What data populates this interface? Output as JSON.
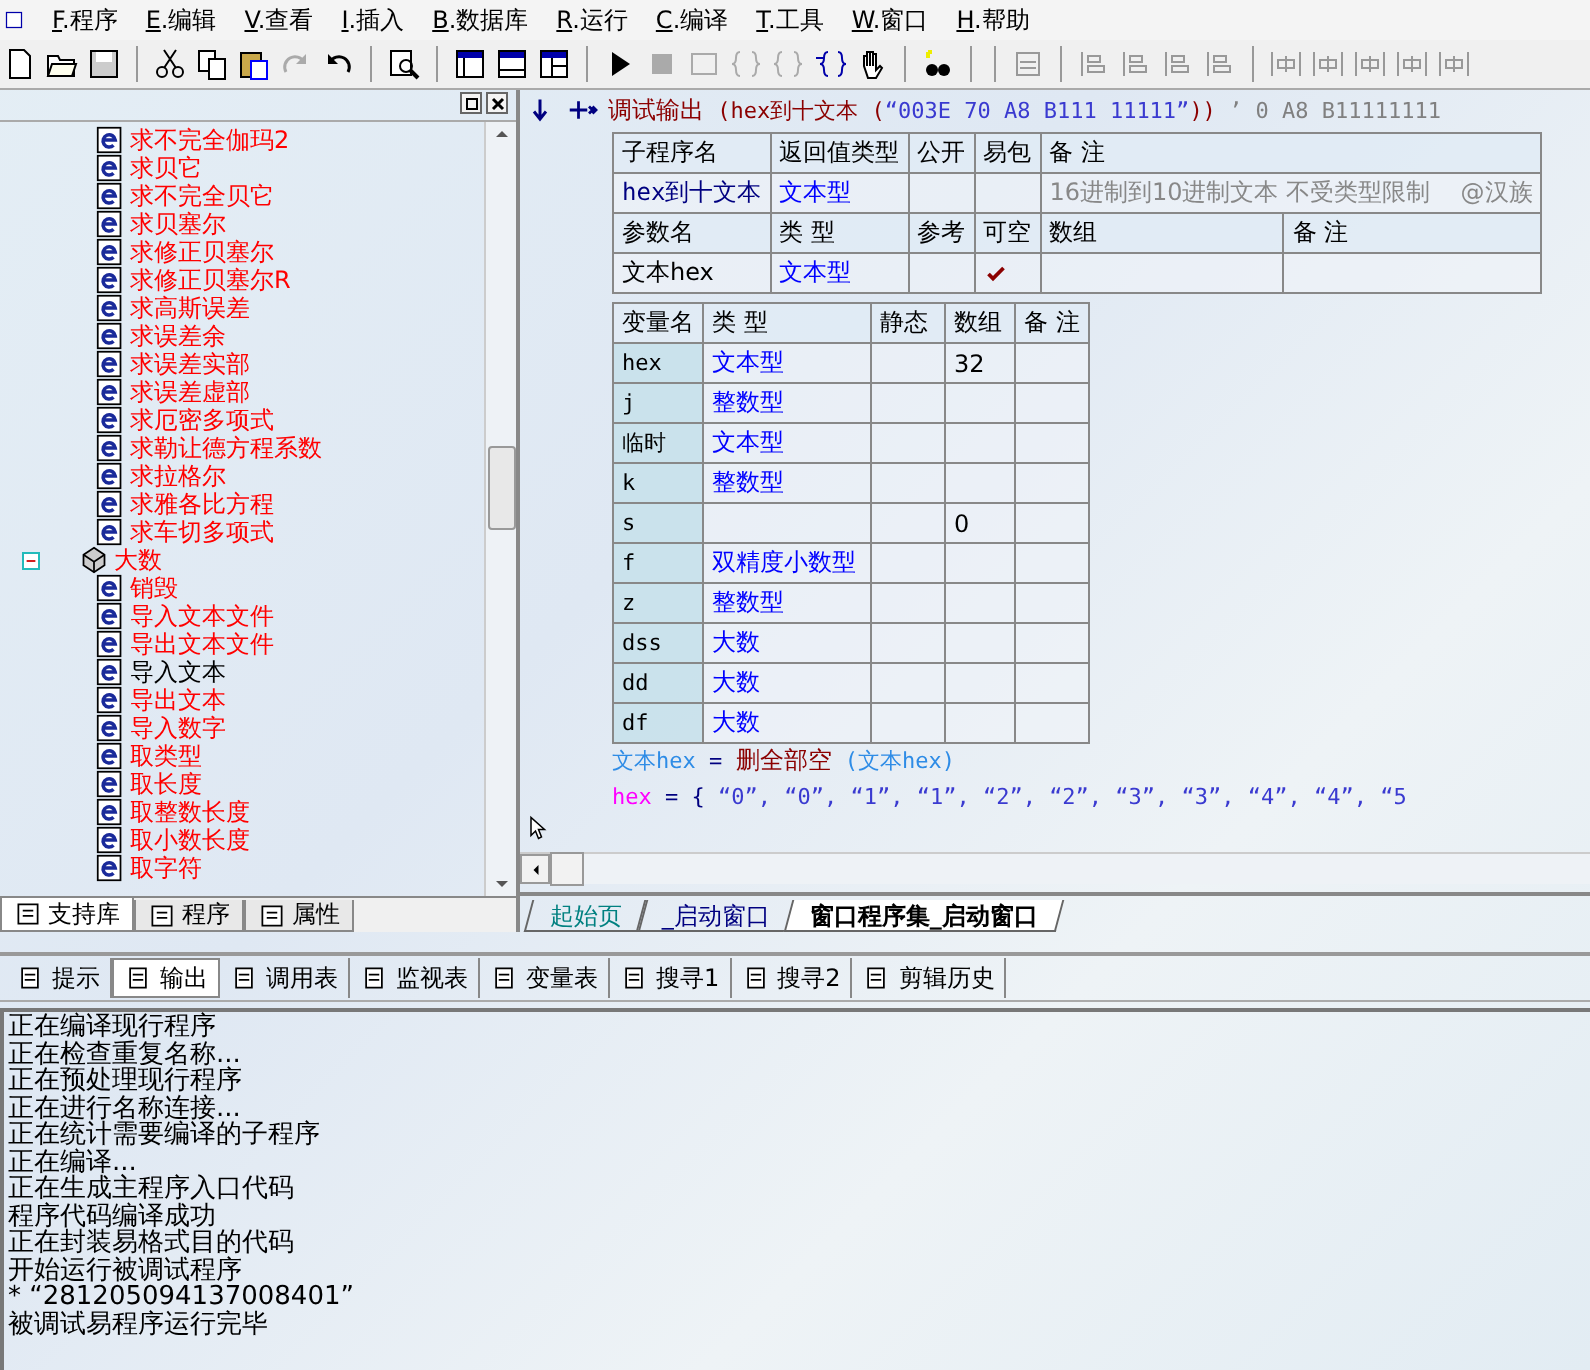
{
  "menu": [
    "F.程序",
    "E.编辑",
    "V.查看",
    "I.插入",
    "B.数据库",
    "R.运行",
    "C.编译",
    "T.工具",
    "W.窗口",
    "H.帮助"
  ],
  "library_tree": {
    "scrolled_group": [
      {
        "label": "求不完全伽玛2",
        "color": "#ff0000"
      },
      {
        "label": "求贝它",
        "color": "#ff0000"
      },
      {
        "label": "求不完全贝它",
        "color": "#ff0000"
      },
      {
        "label": "求贝塞尔",
        "color": "#ff0000"
      },
      {
        "label": "求修正贝塞尔",
        "color": "#ff0000"
      },
      {
        "label": "求修正贝塞尔R",
        "color": "#ff0000"
      },
      {
        "label": "求高斯误差",
        "color": "#ff0000"
      },
      {
        "label": "求误差余",
        "color": "#ff0000"
      },
      {
        "label": "求误差实部",
        "color": "#ff0000"
      },
      {
        "label": "求误差虚部",
        "color": "#ff0000"
      },
      {
        "label": "求厄密多项式",
        "color": "#ff0000"
      },
      {
        "label": "求勒让德方程系数",
        "color": "#ff0000"
      },
      {
        "label": "求拉格尔",
        "color": "#ff0000"
      },
      {
        "label": "求雅各比方程",
        "color": "#ff0000"
      },
      {
        "label": "求车切多项式",
        "color": "#ff0000"
      }
    ],
    "nodes": [
      {
        "label": "大数",
        "color": "#ff0000",
        "expanded": true,
        "children": [
          {
            "label": "销毁",
            "color": "#ff0000"
          },
          {
            "label": "导入文本文件",
            "color": "#ff0000"
          },
          {
            "label": "导出文本文件",
            "color": "#ff0000"
          },
          {
            "label": "导入文本",
            "color": "#000000"
          },
          {
            "label": "导出文本",
            "color": "#ff0000"
          },
          {
            "label": "导入数字",
            "color": "#ff0000"
          },
          {
            "label": "取类型",
            "color": "#ff0000"
          },
          {
            "label": "取长度",
            "color": "#ff0000"
          },
          {
            "label": "取整数长度",
            "color": "#ff0000"
          },
          {
            "label": "取小数长度",
            "color": "#ff0000"
          },
          {
            "label": "取字符",
            "color": "#ff0000"
          }
        ]
      }
    ]
  },
  "left_tabs": [
    {
      "label": "支持库",
      "selected": true
    },
    {
      "label": "程序",
      "selected": false
    },
    {
      "label": "属性",
      "selected": false
    }
  ],
  "editor": {
    "first_line": [
      {
        "text": "调试输出",
        "kind": "command"
      },
      {
        "text": " (hex到十文本 (",
        "kind": "call"
      },
      {
        "text": "“003E 70 A8 B111 11111”",
        "kind": "string"
      },
      {
        "text": "))",
        "kind": "call"
      },
      {
        "text": " ’ 0 A8 B11111111",
        "kind": "comment"
      }
    ],
    "sub_table": {
      "header": [
        "子程序名",
        "返回值类型",
        "公开",
        "易包",
        "备 注"
      ],
      "name": "hex到十文本",
      "return_type": "文本型",
      "public": false,
      "easy_pack": false,
      "note": "16进制到10进制文本 不受类型限制    @汉族",
      "param_header": [
        "参数名",
        "类 型",
        "参考",
        "可空",
        "数组",
        "备 注"
      ],
      "params": [
        {
          "name": "文本hex",
          "type": "文本型",
          "reference": false,
          "nullable": true,
          "array": false
        }
      ]
    },
    "var_table": {
      "header": [
        "变量名",
        "类 型",
        "静态",
        "数组",
        "备 注"
      ],
      "rows": [
        {
          "name": "hex",
          "type": "文本型",
          "static": false,
          "array": "32"
        },
        {
          "name": "j",
          "type": "整数型",
          "static": false
        },
        {
          "name": "临时",
          "type": "文本型",
          "static": false
        },
        {
          "name": "k",
          "type": "整数型",
          "static": false
        },
        {
          "name": "s",
          "static": false,
          "array": "0"
        },
        {
          "name": "f",
          "type": "双精度小数型",
          "static": false
        },
        {
          "name": "z",
          "type": "整数型",
          "static": false
        },
        {
          "name": "dss",
          "type": "大数",
          "static": false
        },
        {
          "name": "dd",
          "type": "大数",
          "static": false
        },
        {
          "name": "df",
          "type": "大数",
          "static": false
        }
      ]
    },
    "code_lines": [
      [
        {
          "text": "文本hex",
          "kind": "variable"
        },
        {
          "text": " = ",
          "kind": "operator"
        },
        {
          "text": "删全部空",
          "kind": "command"
        },
        {
          "text": " (文本hex)",
          "kind": "variable"
        }
      ],
      [
        {
          "text": "hex",
          "kind": "array_variable"
        },
        {
          "text": " = { ",
          "kind": "operator"
        },
        {
          "text": "“0”, “0”, “1”, “1”, “2”, “2”, “3”, “3”, “4”, “4”, “5",
          "kind": "string"
        }
      ]
    ]
  },
  "editor_tabs": [
    {
      "label": "起始页",
      "selected": false,
      "color": "#008080"
    },
    {
      "label": "_启动窗口",
      "selected": false,
      "color": "#000080"
    },
    {
      "label": "窗口程序集_启动窗口",
      "selected": true,
      "color": "#000000"
    }
  ],
  "output_tabs": [
    {
      "label": "提示",
      "selected": false
    },
    {
      "label": "输出",
      "selected": true
    },
    {
      "label": "调用表",
      "selected": false
    },
    {
      "label": "监视表",
      "selected": false
    },
    {
      "label": "变量表",
      "selected": false
    },
    {
      "label": "搜寻1",
      "selected": false
    },
    {
      "label": "搜寻2",
      "selected": false
    },
    {
      "label": "剪辑历史",
      "selected": false
    }
  ],
  "output_lines": [
    "正在编译现行程序",
    "正在检查重复名称...",
    "正在预处理现行程序",
    "正在进行名称连接...",
    "正在统计需要编译的子程序",
    "正在编译...",
    "正在生成主程序入口代码",
    "程序代码编译成功",
    "正在封装易格式目的代码",
    "开始运行被调试程序",
    "* “281205094137008401”",
    "被调试易程序运行完毕"
  ]
}
